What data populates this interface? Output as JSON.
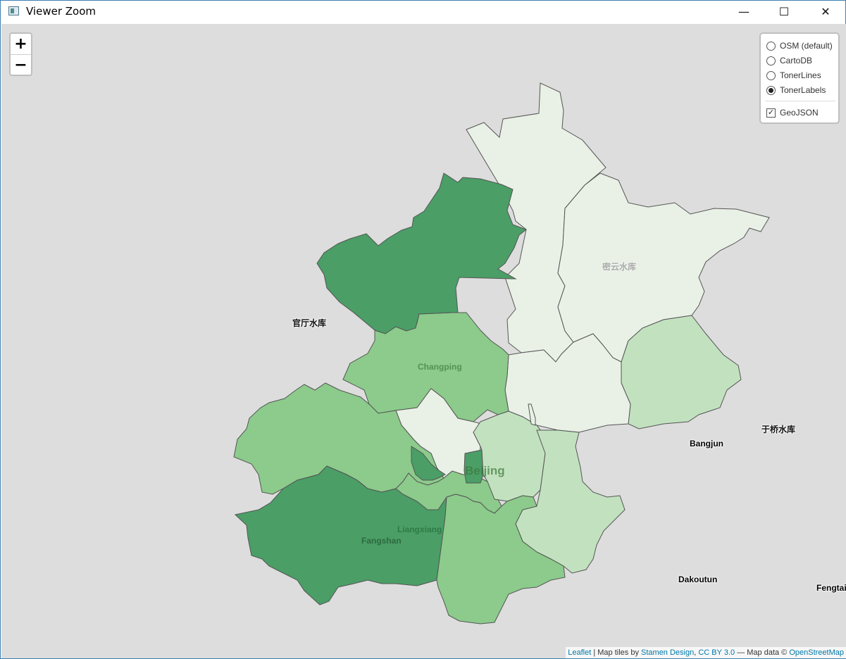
{
  "window": {
    "title": "Viewer Zoom",
    "minimize": "—",
    "maximize": "☐",
    "close": "✕"
  },
  "zoom": {
    "in": "+",
    "out": "−"
  },
  "layers": {
    "base": [
      {
        "label": "OSM (default)",
        "selected": false
      },
      {
        "label": "CartoDB",
        "selected": false
      },
      {
        "label": "TonerLines",
        "selected": false
      },
      {
        "label": "TonerLabels",
        "selected": true
      }
    ],
    "overlays": [
      {
        "label": "GeoJSON",
        "checked": true
      }
    ]
  },
  "labels": {
    "guanting": "官厅水库",
    "miyun": "密云水库",
    "changping": "Changping",
    "beijing": "Beijing",
    "liangxiang": "Liangxiang",
    "fangshan": "Fangshan",
    "yuqiao": "于桥水库",
    "bangjun": "Bangjun",
    "dakoutun": "Dakoutun",
    "fengtai": "Fengtai"
  },
  "attribution": {
    "leaflet": "Leaflet",
    "sep": " | Map tiles by ",
    "stamen": "Stamen Design",
    "comma": ", ",
    "cc": "CC BY 3.0",
    "dash": " — Map data © ",
    "osm": "OpenStreetMap"
  },
  "colors": {
    "map_background": "#dddddd",
    "fill_very_light": "#e9f1e6",
    "fill_light": "#c2e2bf",
    "fill_medium": "#8ccb8b",
    "fill_dark": "#4a9e66",
    "link": "#0078A8"
  }
}
